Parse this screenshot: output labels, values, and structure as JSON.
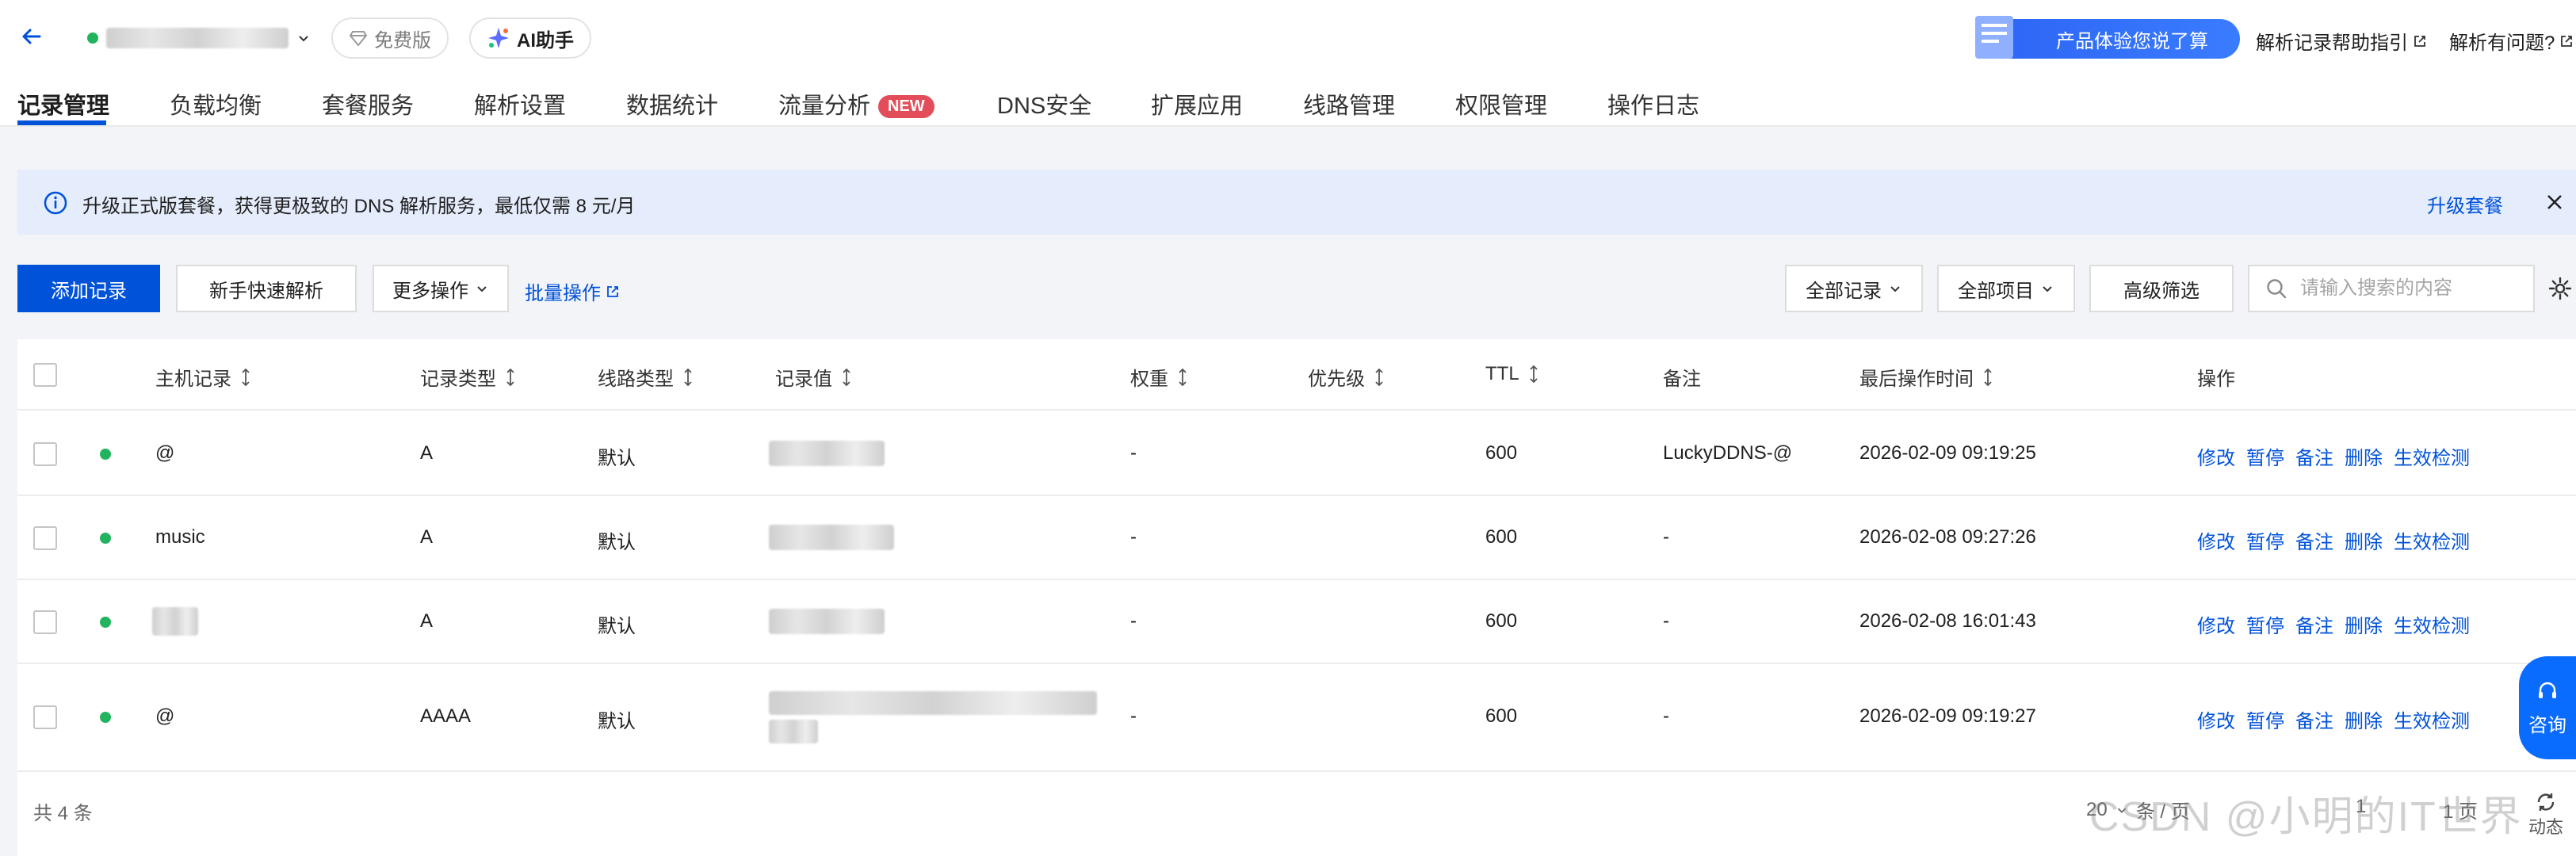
{
  "header": {
    "free_label": "免费版",
    "ai_label": "AI助手",
    "promo_label": "产品体验您说了算",
    "help_link": "解析记录帮助指引",
    "question_link": "解析有问题?"
  },
  "tabs": [
    {
      "label": "记录管理",
      "active": true
    },
    {
      "label": "负载均衡"
    },
    {
      "label": "套餐服务"
    },
    {
      "label": "解析设置"
    },
    {
      "label": "数据统计"
    },
    {
      "label": "流量分析",
      "badge": "NEW"
    },
    {
      "label": "DNS安全"
    },
    {
      "label": "扩展应用"
    },
    {
      "label": "线路管理"
    },
    {
      "label": "权限管理"
    },
    {
      "label": "操作日志"
    }
  ],
  "notice": {
    "text": "升级正式版套餐，获得更极致的 DNS 解析服务，最低仅需 8 元/月",
    "link": "升级套餐"
  },
  "toolbar": {
    "add_record": "添加记录",
    "quick_resolve": "新手快速解析",
    "more_actions": "更多操作",
    "batch": "批量操作",
    "filter_all_records": "全部记录",
    "filter_all_items": "全部项目",
    "advanced_filter": "高级筛选",
    "search_placeholder": "请输入搜索的内容"
  },
  "table": {
    "headers": {
      "host": "主机记录",
      "type": "记录类型",
      "line": "线路类型",
      "value": "记录值",
      "weight": "权重",
      "priority": "优先级",
      "ttl": "TTL",
      "remark": "备注",
      "last_time": "最后操作时间",
      "actions": "操作"
    },
    "rows": [
      {
        "host": "@",
        "type": "A",
        "line": "默认",
        "weight": "-",
        "ttl": "600",
        "remark": "LuckyDDNS-@",
        "last_time": "2026-02-09 09:19:25"
      },
      {
        "host": "music",
        "type": "A",
        "line": "默认",
        "weight": "-",
        "ttl": "600",
        "remark": "-",
        "last_time": "2026-02-08 09:27:26"
      },
      {
        "host": "",
        "type": "A",
        "line": "默认",
        "weight": "-",
        "ttl": "600",
        "remark": "-",
        "last_time": "2026-02-08 16:01:43"
      },
      {
        "host": "@",
        "type": "AAAA",
        "line": "默认",
        "weight": "-",
        "ttl": "600",
        "remark": "-",
        "last_time": "2026-02-09 09:19:27"
      }
    ],
    "row_actions": [
      "修改",
      "暂停",
      "备注",
      "删除",
      "生效检测"
    ]
  },
  "footer": {
    "total": "共 4 条",
    "page_size": "20",
    "per_page_label": "条 / 页",
    "page_current": "1",
    "page_suffix": "1 页"
  },
  "watermark": "CSDN @小明的IT世界",
  "float": {
    "consult": "咨询",
    "dynamic": "动态"
  },
  "colors": {
    "primary": "#0052d9",
    "status_green": "#22b35e",
    "notice_bg": "#e5ecfb",
    "new_badge": "#e34d59"
  }
}
